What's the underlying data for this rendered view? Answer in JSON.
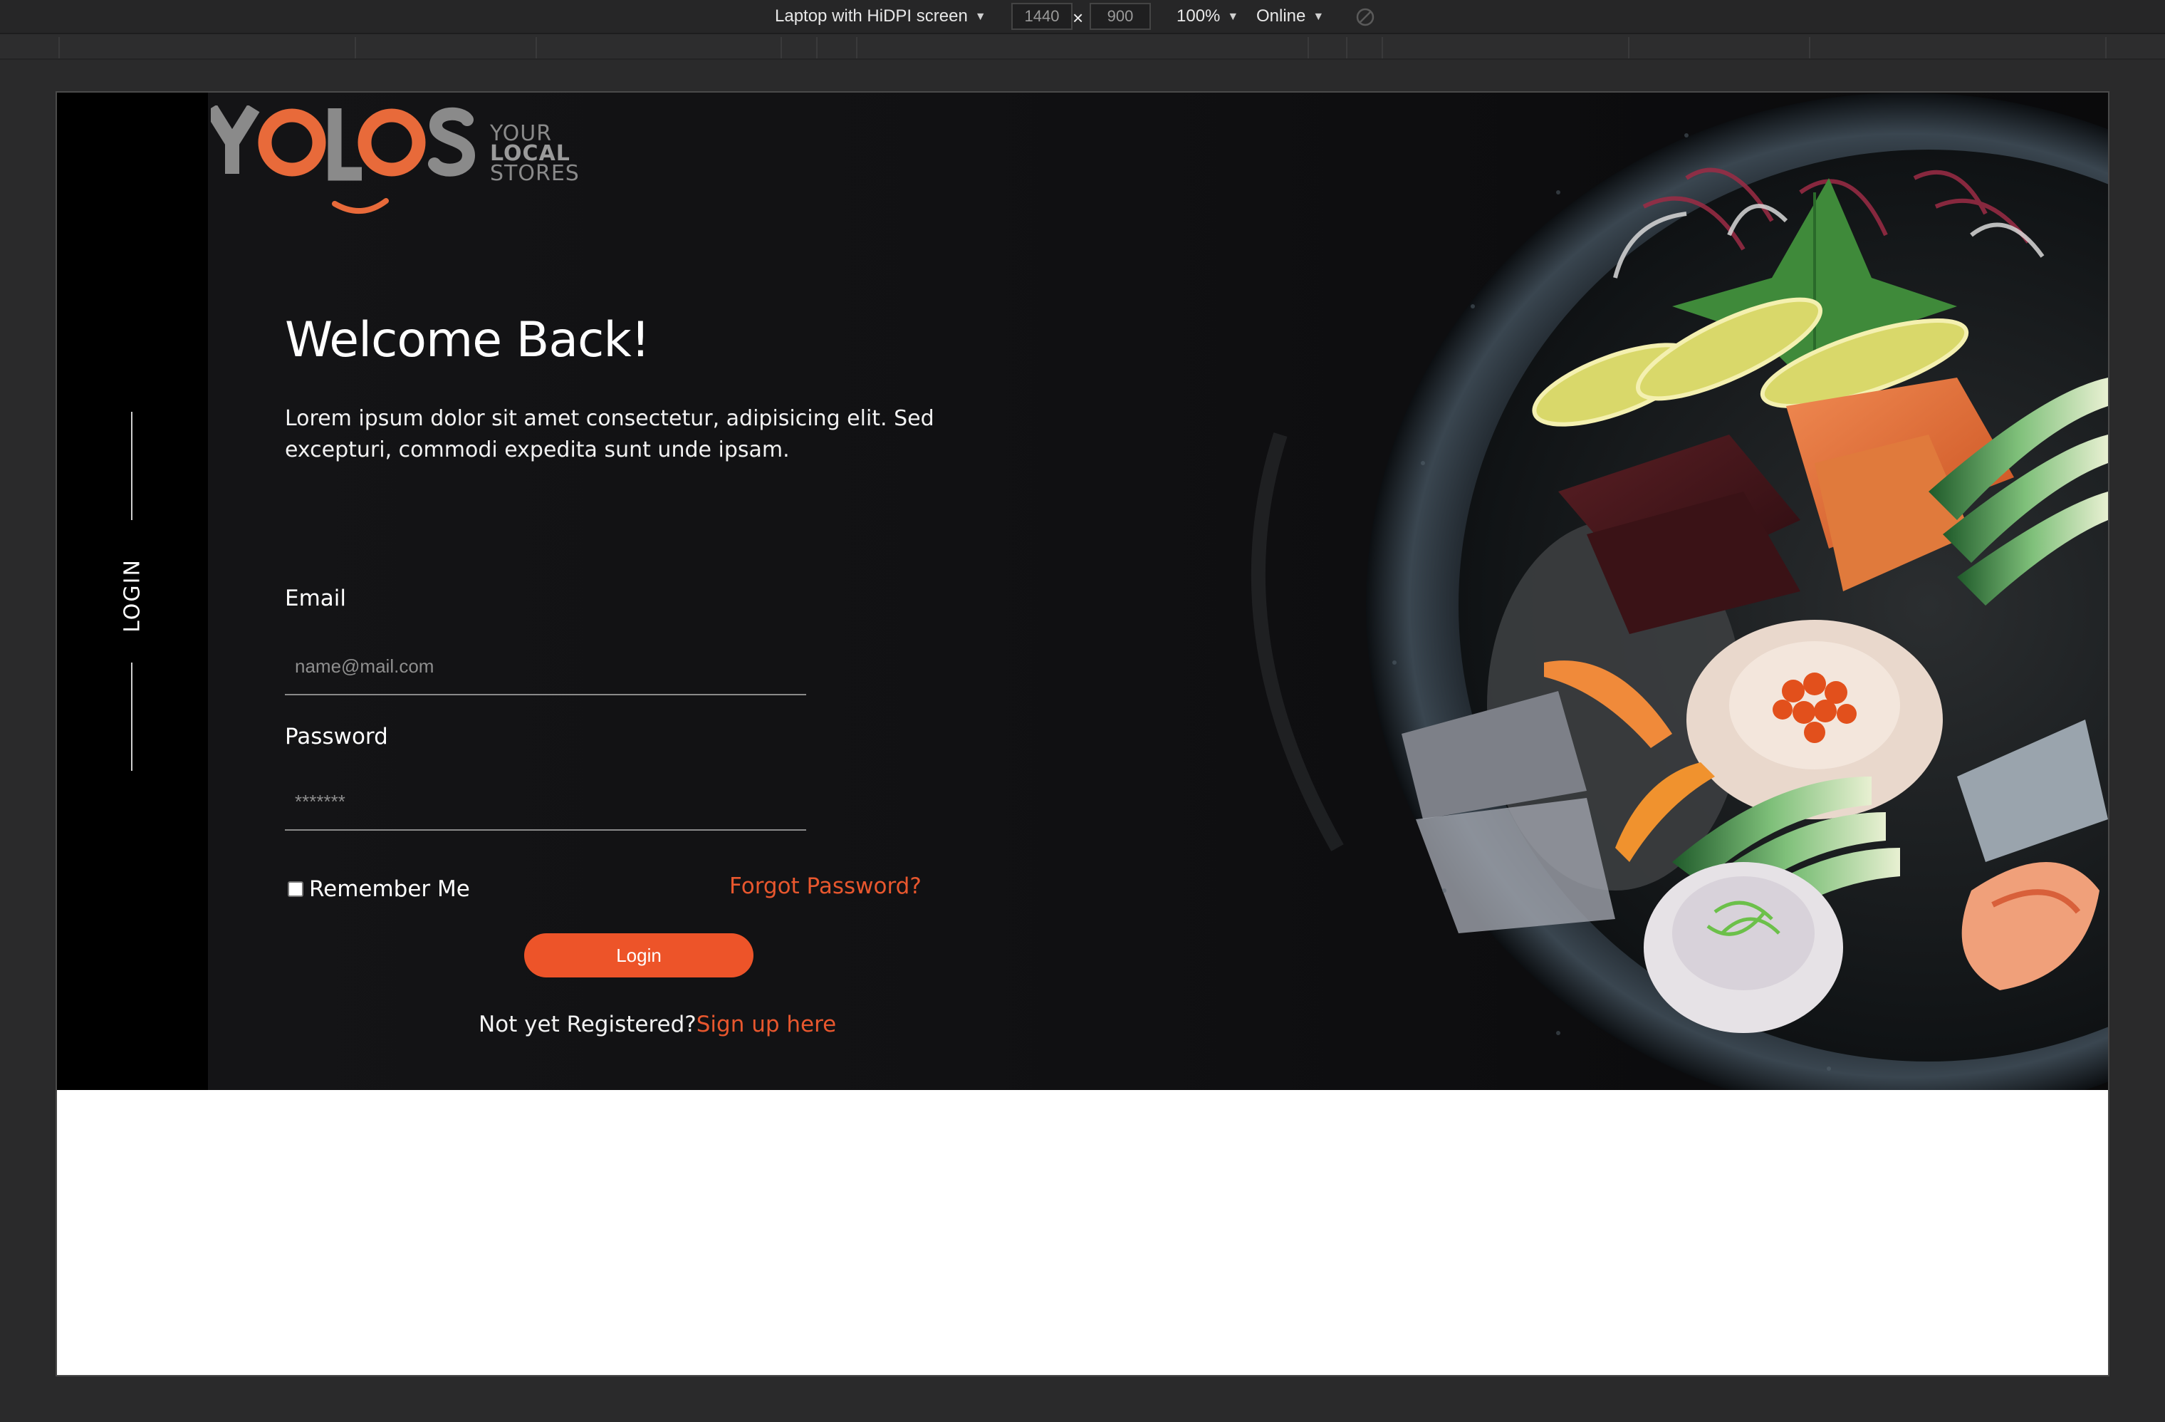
{
  "devtools": {
    "device": "Laptop with HiDPI screen",
    "width": "1440",
    "times": "×",
    "height": "900",
    "zoom": "100%",
    "network": "Online",
    "arrow": "▼"
  },
  "brand": {
    "logo_text": "YOLOS",
    "tagline": [
      "YOUR",
      "LOCAL",
      "STORES"
    ],
    "accent_color": "#ed5429",
    "grey_color": "#8a8a8a"
  },
  "sidebar": {
    "label": "LOGIN"
  },
  "form": {
    "heading": "Welcome Back!",
    "description": "Lorem ipsum dolor sit amet consectetur, adipisicing elit. Sed excepturi, commodi expedita sunt unde ipsam.",
    "email_label": "Email",
    "email_placeholder": "name@mail.com",
    "password_label": "Password",
    "password_placeholder": "*******",
    "remember_label": "Remember Me",
    "forgot_label": "Forgot Password?",
    "login_button": "Login",
    "signup_question": "Not yet Registered?",
    "signup_link": "Sign up here"
  },
  "icons": {
    "rotate": "rotate-icon",
    "food_image": "sushi-bowl-image"
  }
}
